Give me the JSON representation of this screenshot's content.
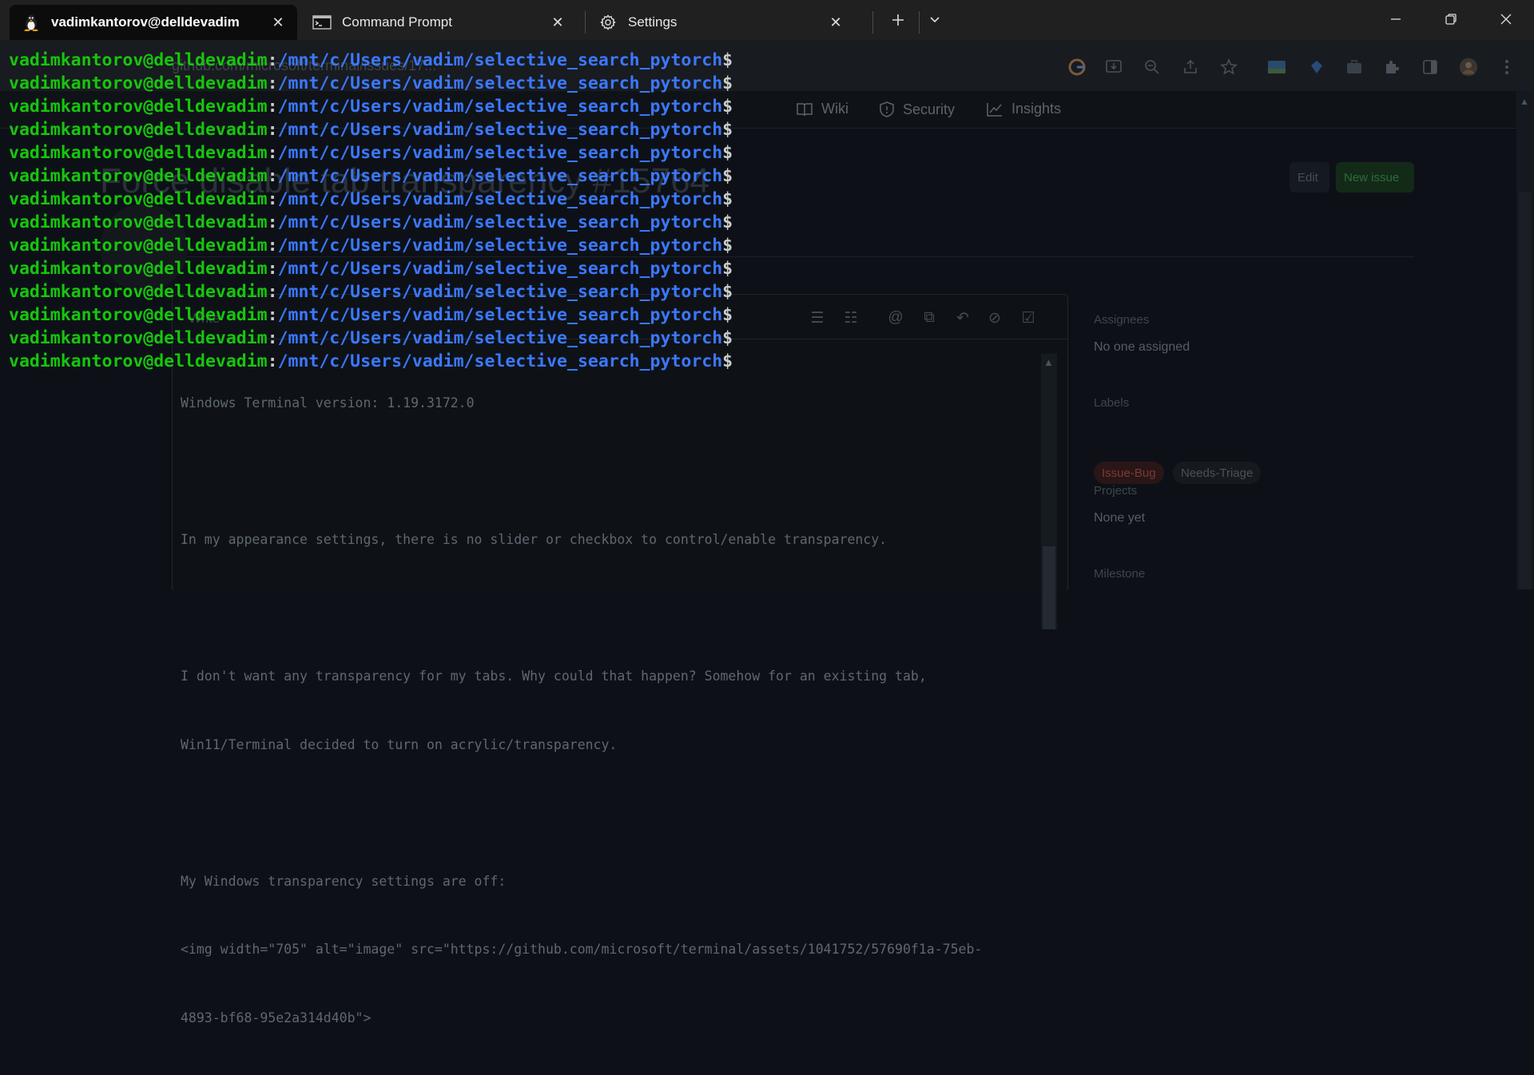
{
  "tabs": [
    {
      "label": "vadimkantorov@delldevadim",
      "icon": "linux-tux-icon",
      "active": true
    },
    {
      "label": "Command Prompt",
      "icon": "command-prompt-icon",
      "active": false
    },
    {
      "label": "Settings",
      "icon": "gear-icon",
      "active": false
    }
  ],
  "terminal": {
    "user_host": "vadimkantorov@delldevadim",
    "separator": ":",
    "path": "/mnt/c/Users/vadim/selective_search_pytorch",
    "prompt_symbol": "$",
    "line_count": 14,
    "colors": {
      "user": "#16c60c",
      "path": "#3b78ff",
      "default": "#cccccc",
      "background": "#0c0c0c"
    }
  },
  "background_page": {
    "address": "github.com/microsoft/terminal/issues/17...",
    "nav_items": [
      "Wiki",
      "Security",
      "Insights"
    ],
    "issue_title": "Force disable tab transparency #15764",
    "buttons": {
      "edit": "Edit",
      "new_issue": "New issue"
    },
    "editor_tab": "Write",
    "textarea_lines": [
      "Windows Terminal version: 1.19.3172.0",
      "",
      "In my appearance settings, there is no slider or checkbox to control/enable transparency.",
      "",
      "I don't want any transparency for my tabs. Why could that happen? Somehow for an existing tab,",
      "Win11/Terminal decided to turn on acrylic/transparency.",
      "",
      "My Windows transparency settings are off:",
      "<img width=\"705\" alt=\"image\" src=\"https://github.com/microsoft/terminal/assets/1041752/57690f1a-75eb-",
      "4893-bf68-95e2a314d40b\">"
    ],
    "sidebar": {
      "assignees_heading": "Assignees",
      "assignees_value": "No one assigned",
      "labels_heading": "Labels",
      "labels": [
        "Issue-Bug",
        "Needs-Triage"
      ],
      "projects_heading": "Projects",
      "projects_value": "None yet",
      "milestone_heading": "Milestone"
    }
  }
}
